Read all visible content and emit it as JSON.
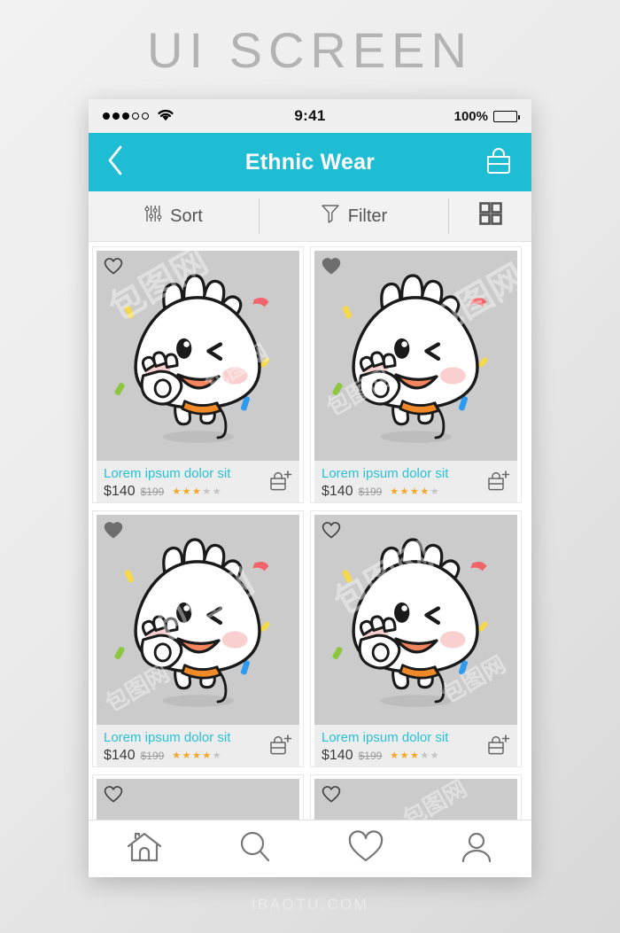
{
  "page": {
    "title": "UI SCREEN",
    "footer": "IBAOTU.COM",
    "watermark": "包图网"
  },
  "colors": {
    "accent_teal": "#1ebdd4",
    "link_cyan": "#29c1d8",
    "star_orange": "#f5a623",
    "image_gray": "#cbcbcb",
    "info_gray": "#ededed",
    "toolbar_gray": "#f2f2f2"
  },
  "status_bar": {
    "signal_dots_filled": 3,
    "signal_dots_empty": 2,
    "wifi_icon": "wifi-icon",
    "time": "9:41",
    "battery_percent": "100%",
    "battery_icon": "battery-full-icon"
  },
  "navbar": {
    "back_icon": "chevron-left-icon",
    "title": "Ethnic Wear",
    "bag_icon": "shopping-bag-icon"
  },
  "toolbar": {
    "sort_label": "Sort",
    "sort_icon": "sliders-icon",
    "filter_label": "Filter",
    "filter_icon": "funnel-icon",
    "grid_icon": "grid-view-icon"
  },
  "products": [
    {
      "title": "Lorem ipsum dolor sit",
      "price": "$140",
      "old_price": "$199",
      "rating": 3,
      "max_rating": 5,
      "favorited": false,
      "add_icon": "add-to-bag-icon"
    },
    {
      "title": "Lorem ipsum dolor sit",
      "price": "$140",
      "old_price": "$199",
      "rating": 4,
      "max_rating": 5,
      "favorited": true,
      "add_icon": "add-to-bag-icon"
    },
    {
      "title": "Lorem ipsum dolor sit",
      "price": "$140",
      "old_price": "$199",
      "rating": 4,
      "max_rating": 5,
      "favorited": true,
      "add_icon": "add-to-bag-icon"
    },
    {
      "title": "Lorem ipsum dolor sit",
      "price": "$140",
      "old_price": "$199",
      "rating": 3,
      "max_rating": 5,
      "favorited": false,
      "add_icon": "add-to-bag-icon"
    }
  ],
  "partial_products": [
    {
      "favorited": false
    },
    {
      "favorited": false
    }
  ],
  "tabbar": {
    "items": [
      {
        "name": "home",
        "icon": "home-icon"
      },
      {
        "name": "search",
        "icon": "search-icon"
      },
      {
        "name": "wishlist",
        "icon": "heart-icon"
      },
      {
        "name": "profile",
        "icon": "person-icon"
      }
    ]
  }
}
